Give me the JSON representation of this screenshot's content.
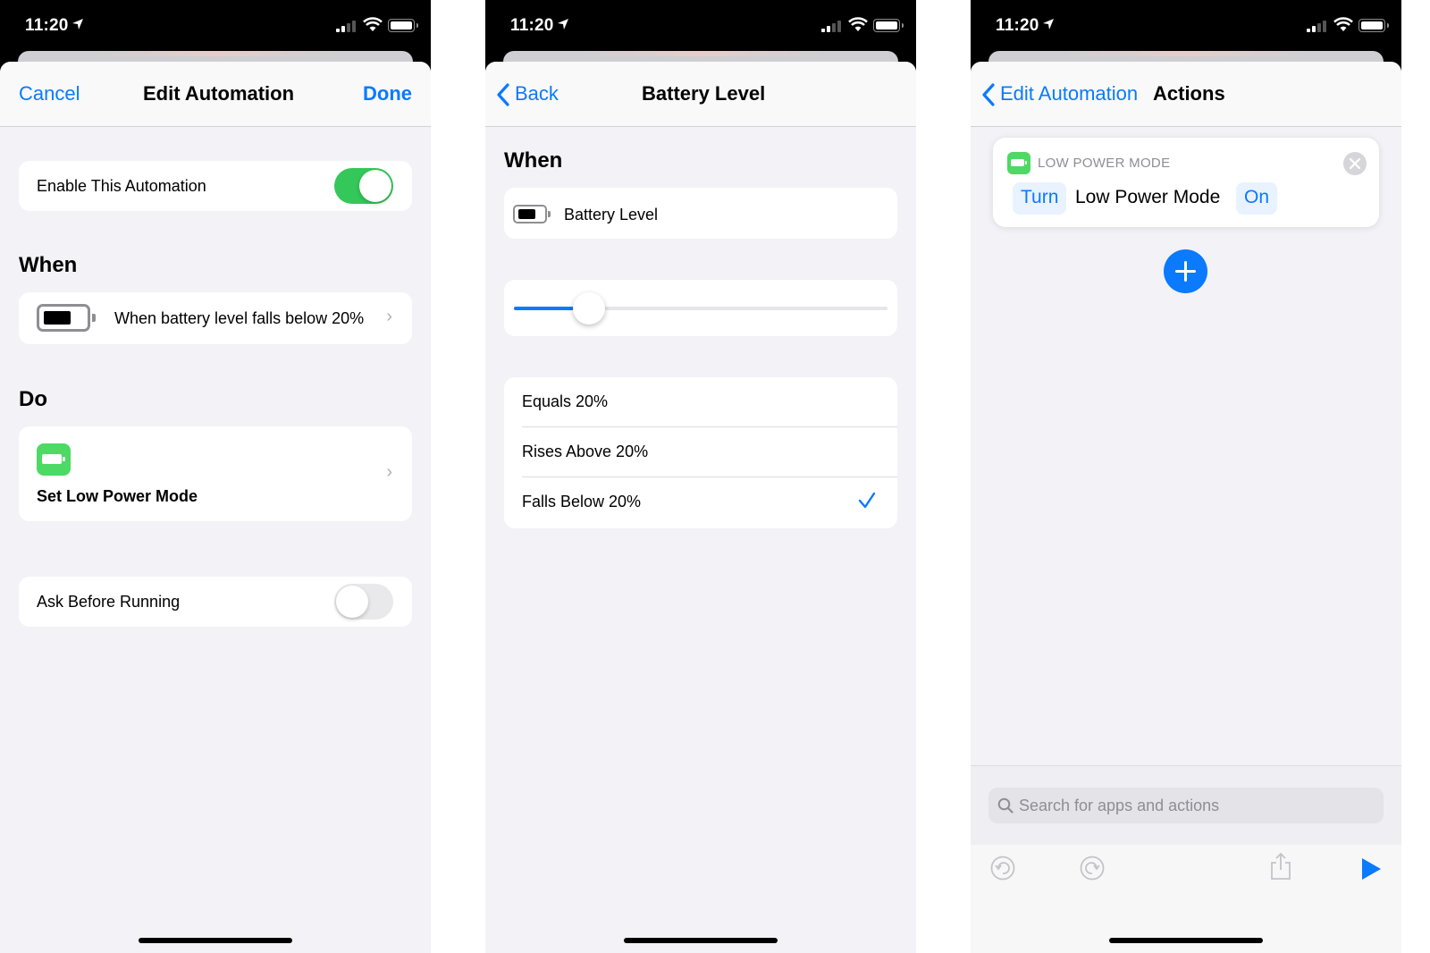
{
  "colors": {
    "accent": "#0a7aff",
    "toggle_on": "#34c759",
    "app_green": "#4cd964",
    "background": "#f2f2f7"
  },
  "status_bar": {
    "time": "11:20"
  },
  "screen1": {
    "nav": {
      "cancel": "Cancel",
      "title": "Edit Automation",
      "done": "Done"
    },
    "enable_label": "Enable This Automation",
    "enable_on": true,
    "when_heading": "When",
    "trigger_text": "When battery level falls below 20%",
    "do_heading": "Do",
    "action_label": "Set Low Power Mode",
    "ask_label": "Ask Before Running",
    "ask_on": false
  },
  "screen2": {
    "nav": {
      "back": "Back",
      "title": "Battery Level"
    },
    "when_heading": "When",
    "trigger_label": "Battery Level",
    "slider_value_percent": 20,
    "options": [
      {
        "label": "Equals 20%",
        "selected": false
      },
      {
        "label": "Rises Above 20%",
        "selected": false
      },
      {
        "label": "Falls Below 20%",
        "selected": true
      }
    ]
  },
  "screen3": {
    "nav": {
      "back": "Edit Automation",
      "title": "Actions"
    },
    "action": {
      "header": "LOW POWER MODE",
      "verb": "Turn",
      "object": "Low Power Mode",
      "state": "On"
    },
    "search_placeholder": "Search for apps and actions",
    "toolbar_icons": [
      "undo-icon",
      "redo-icon",
      "share-icon",
      "play-icon"
    ]
  }
}
